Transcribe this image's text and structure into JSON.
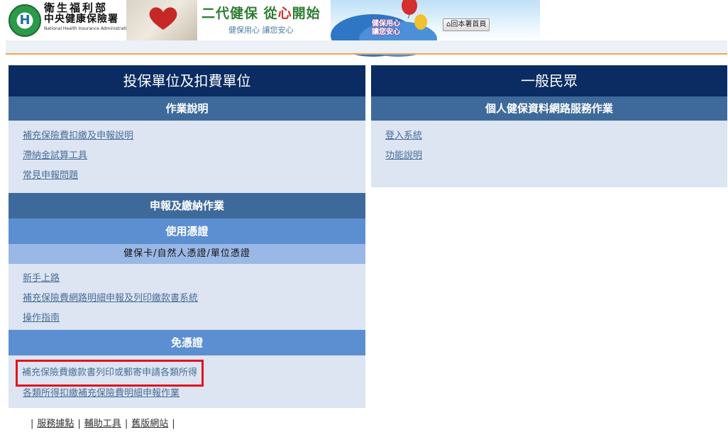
{
  "header": {
    "org_name_1": "衛生福利部",
    "org_name_2": "中央健康保險署",
    "org_name_en": "National Health Insurance Administration, Ministry of Health and Welfare",
    "slogan_part1": "二代健保 從",
    "slogan_heart": "心",
    "slogan_part2": "開始",
    "slogan_sub": "健保用心  讓您安心",
    "balloon_msg_1": "健保用心",
    "balloon_msg_2": "讓您安心",
    "home_button": "回本署首頁"
  },
  "left_panel": {
    "title": "投保單位及扣費單位",
    "section_instructions": {
      "label": "作業說明",
      "links": [
        "補充保險費扣繳及申報說明",
        "滯納金試算工具",
        "常見申報問題"
      ]
    },
    "section_filing": {
      "label": "申報及繳納作業"
    },
    "section_cert": {
      "label": "使用憑證",
      "cred_types": "健保卡/自然人憑證/單位憑證",
      "links": [
        "新手上路",
        "補充保險費網路明細申報及列印繳款書系統",
        "操作指南"
      ]
    },
    "section_nocert": {
      "label": "免憑證",
      "links": [
        "補充保險費繳款書列印或郵寄申請各類所得",
        "各類所得扣繳補充保險費明細申報作業"
      ]
    }
  },
  "right_panel": {
    "title": "一般民眾",
    "section": {
      "label": "個人健保資料網路服務作業",
      "links": [
        "登入系統",
        "功能說明"
      ]
    }
  },
  "footer": {
    "links": [
      "服務據點",
      "輔助工具",
      "舊版網站"
    ]
  },
  "colors": {
    "title_bar": "#0b2c62",
    "section_bar": "#3e6a9b",
    "sub_bar": "#5b8fd1",
    "cred_bar": "#9ab8e6",
    "link_bg": "#dce5f1",
    "highlight_border": "#e0141e",
    "orange_line": "#f7a24b"
  }
}
